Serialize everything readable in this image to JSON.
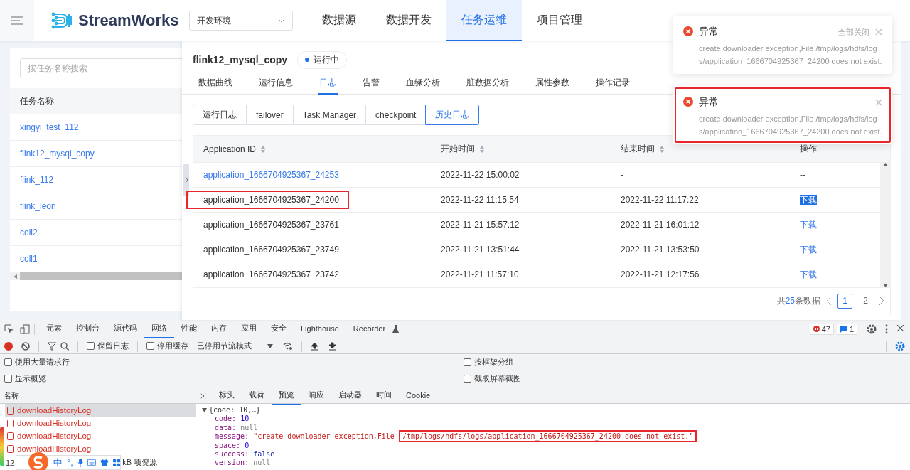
{
  "header": {
    "logo": "StreamWorks",
    "env_select": "开发环境",
    "nav": [
      {
        "label": "数据源",
        "selected": false
      },
      {
        "label": "数据开发",
        "selected": false
      },
      {
        "label": "任务运维",
        "selected": true
      },
      {
        "label": "项目管理",
        "selected": false
      }
    ]
  },
  "task_list": {
    "search_placeholder": "按任务名称搜索",
    "column": "任务名称",
    "items": [
      {
        "name": "xingyi_test_112"
      },
      {
        "name": "flink12_mysql_copy"
      },
      {
        "name": "flink_112"
      },
      {
        "name": "flink_leon"
      },
      {
        "name": "coll2"
      },
      {
        "name": "coll1"
      }
    ]
  },
  "task": {
    "name": "flink12_mysql_copy",
    "status": "运行中",
    "tabs": [
      {
        "label": "数据曲线",
        "selected": false
      },
      {
        "label": "运行信息",
        "selected": false
      },
      {
        "label": "日志",
        "selected": true
      },
      {
        "label": "告警",
        "selected": false
      },
      {
        "label": "血缘分析",
        "selected": false
      },
      {
        "label": "脏数据分析",
        "selected": false
      },
      {
        "label": "属性参数",
        "selected": false
      },
      {
        "label": "操作记录",
        "selected": false
      }
    ],
    "log_tabs": [
      {
        "label": "运行日志",
        "selected": false
      },
      {
        "label": "failover",
        "selected": false
      },
      {
        "label": "Task Manager",
        "selected": false
      },
      {
        "label": "checkpoint",
        "selected": false
      },
      {
        "label": "历史日志",
        "selected": true
      }
    ],
    "table": {
      "columns": [
        {
          "label": "Application ID",
          "sortable": true
        },
        {
          "label": "开始时间",
          "sortable": true
        },
        {
          "label": "结束时间",
          "sortable": true
        },
        {
          "label": "操作",
          "sortable": false
        }
      ],
      "rows": [
        {
          "app_id": "application_1666704925367_24253",
          "id_link": true,
          "annotated": false,
          "start": "2022-11-22 15:00:02",
          "end": "-",
          "action": "--",
          "action_link": false,
          "highlighted": false
        },
        {
          "app_id": "application_1666704925367_24200",
          "id_link": false,
          "annotated": true,
          "start": "2022-11-22 11:15:54",
          "end": "2022-11-22 11:17:22",
          "action": "下载",
          "action_link": true,
          "highlighted": true
        },
        {
          "app_id": "application_1666704925367_23761",
          "id_link": false,
          "annotated": false,
          "start": "2022-11-21 15:57:12",
          "end": "2022-11-21 16:01:12",
          "action": "下载",
          "action_link": true,
          "highlighted": false
        },
        {
          "app_id": "application_1666704925367_23749",
          "id_link": false,
          "annotated": false,
          "start": "2022-11-21 13:51:44",
          "end": "2022-11-21 13:53:50",
          "action": "下载",
          "action_link": true,
          "highlighted": false
        },
        {
          "app_id": "application_1666704925367_23742",
          "id_link": false,
          "annotated": false,
          "start": "2022-11-21 11:57:10",
          "end": "2022-11-21 12:17:56",
          "action": "下载",
          "action_link": true,
          "highlighted": false
        }
      ]
    },
    "pagination": {
      "total_prefix": "共",
      "total": "25",
      "total_suffix": "条数据",
      "pages": [
        {
          "label": "1",
          "selected": true
        },
        {
          "label": "2",
          "selected": false
        }
      ]
    }
  },
  "notifications": [
    {
      "title": "异常",
      "message": "create downloader exception,File /tmp/logs/hdfs/logs/application_1666704925367_24200 does not exist.",
      "close_all": "全部关闭",
      "annotated": false
    },
    {
      "title": "异常",
      "message": "create downloader exception,File /tmp/logs/hdfs/logs/application_1666704925367_24200 does not exist.",
      "annotated": true
    }
  ],
  "devtools": {
    "tabs": [
      {
        "label": "元素",
        "selected": false
      },
      {
        "label": "控制台",
        "selected": false
      },
      {
        "label": "源代码",
        "selected": false
      },
      {
        "label": "网络",
        "selected": true
      },
      {
        "label": "性能",
        "selected": false
      },
      {
        "label": "内存",
        "selected": false
      },
      {
        "label": "应用",
        "selected": false
      },
      {
        "label": "安全",
        "selected": false
      },
      {
        "label": "Lighthouse",
        "selected": false
      },
      {
        "label": "Recorder",
        "selected": false
      }
    ],
    "error_count": "47",
    "message_count": "1",
    "toolbar": {
      "preserve_log": {
        "label": "保留日志",
        "checked": false
      },
      "disable_cache": {
        "label": "停用缓存",
        "checked": false
      },
      "throttling": "已停用节流模式"
    },
    "options": [
      {
        "label": "使用大量请求行",
        "checked": false
      },
      {
        "label": "按框架分组",
        "checked": false
      },
      {
        "label": "显示概览",
        "checked": false
      },
      {
        "label": "截取屏幕截图",
        "checked": false
      }
    ],
    "requests_header": "名称",
    "requests": [
      {
        "name": "downloadHistoryLog",
        "selected": true
      },
      {
        "name": "downloadHistoryLog",
        "selected": false
      },
      {
        "name": "downloadHistoryLog",
        "selected": false
      },
      {
        "name": "downloadHistoryLog",
        "selected": false
      }
    ],
    "status_parts": [
      "12",
      "kB 项资源"
    ],
    "detail_tabs": [
      {
        "label": "标头",
        "selected": false
      },
      {
        "label": "载荷",
        "selected": false
      },
      {
        "label": "预览",
        "selected": true
      },
      {
        "label": "响应",
        "selected": false
      },
      {
        "label": "启动器",
        "selected": false
      },
      {
        "label": "时间",
        "selected": false
      },
      {
        "label": "Cookie",
        "selected": false
      }
    ],
    "preview_summary": "{code: 10,…}",
    "preview": [
      {
        "key": "code:",
        "value": "10",
        "kind": "number"
      },
      {
        "key": "data:",
        "value": "null",
        "kind": "null"
      },
      {
        "key": "message:",
        "value": "\"create downloader exception,File",
        "highlight": "/tmp/logs/hdfs/logs/application_1666704925367_24200 does not exist.\"",
        "kind": "string"
      },
      {
        "key": "space:",
        "value": "0",
        "kind": "number"
      },
      {
        "key": "success:",
        "value": "false",
        "kind": "bool"
      },
      {
        "key": "version:",
        "value": "null",
        "kind": "null"
      }
    ]
  },
  "ime_bar": {
    "mode": "中",
    "punct": "°,"
  }
}
